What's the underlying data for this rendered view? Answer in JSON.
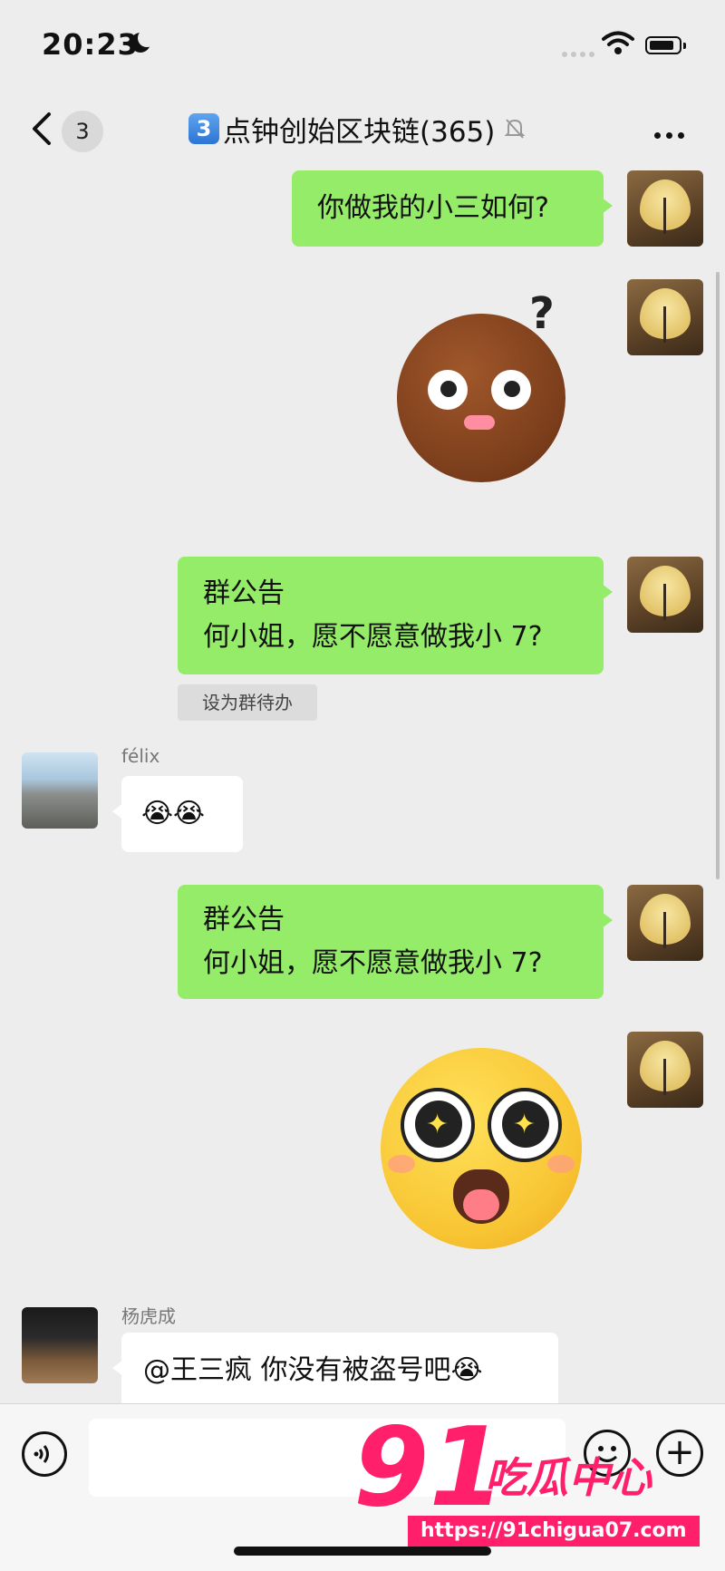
{
  "status": {
    "time": "20:23"
  },
  "header": {
    "unread": "3",
    "group_number": "3",
    "title": "点钟创始区块链(365)"
  },
  "messages": {
    "m1": "你做我的小三如何?",
    "m3_line1": "群公告",
    "m3_line2": "何小姐，愿不愿意做我小 7?",
    "todo": "设为群待办",
    "sender1": "félix",
    "m4": "😭😭",
    "m5_line1": "群公告",
    "m5_line2": "何小姐，愿不愿意做我小 7?",
    "sender2": "杨虎成",
    "m7": "@王三疯 你没有被盗号吧😭"
  },
  "watermark": {
    "num": "91",
    "cn": "吃瓜中心",
    "url": "https://91chigua07.com"
  },
  "icons": [
    "back-icon",
    "mute-bell-icon",
    "more-icon",
    "voice-icon",
    "emoji-icon",
    "plus-icon",
    "wifi-icon",
    "battery-icon",
    "moon-icon"
  ]
}
